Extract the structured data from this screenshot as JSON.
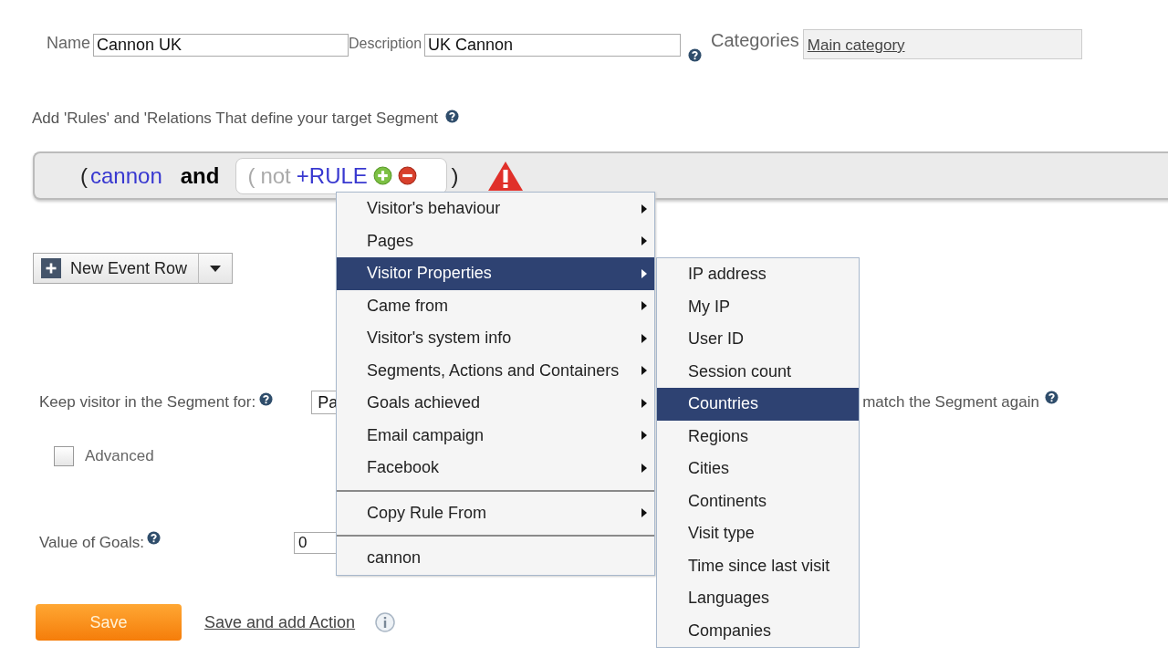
{
  "form": {
    "name": {
      "label": "Name",
      "value": "Cannon UK"
    },
    "description": {
      "label": "Description",
      "value": "UK Cannon"
    },
    "categories": {
      "label": "Categories",
      "link": "Main category"
    }
  },
  "rules_prompt": "Add 'Rules' and 'Relations That define your target Segment",
  "rule_bar": {
    "open": "(",
    "rule": "cannon",
    "operator": "and",
    "group": {
      "open": "(",
      "negation": "not",
      "add": "+RULE"
    },
    "close": ")"
  },
  "new_event_row": "New Event Row",
  "keep": {
    "label": "Keep visitor in the Segment for:",
    "select": "Pa",
    "tail": "match the Segment again"
  },
  "advanced": {
    "label": "Advanced",
    "checked": false
  },
  "goals": {
    "label": "Value of Goals:",
    "value": "0"
  },
  "save": "Save",
  "save_add": "Save and add Action",
  "menu": {
    "sections": [
      [
        {
          "label": "Visitor's behaviour",
          "kind": "submenu",
          "selected": false
        },
        {
          "label": "Pages",
          "kind": "submenu",
          "selected": false
        },
        {
          "label": "Visitor Properties",
          "kind": "submenu",
          "selected": true
        },
        {
          "label": "Came from",
          "kind": "submenu",
          "selected": false
        },
        {
          "label": "Visitor's system info",
          "kind": "submenu",
          "selected": false
        },
        {
          "label": "Segments, Actions and Containers",
          "kind": "submenu",
          "selected": false
        },
        {
          "label": "Goals achieved",
          "kind": "submenu",
          "selected": false
        },
        {
          "label": "Email campaign",
          "kind": "submenu",
          "selected": false
        },
        {
          "label": "Facebook",
          "kind": "submenu",
          "selected": false
        }
      ],
      [
        {
          "label": "Copy Rule From",
          "kind": "submenu",
          "selected": false
        }
      ],
      [
        {
          "label": "cannon",
          "kind": "plain",
          "selected": false
        }
      ]
    ]
  },
  "submenu": [
    {
      "label": "IP address",
      "selected": false
    },
    {
      "label": "My IP",
      "selected": false
    },
    {
      "label": "User ID",
      "selected": false
    },
    {
      "label": "Session count",
      "selected": false
    },
    {
      "label": "Countries",
      "selected": true
    },
    {
      "label": "Regions",
      "selected": false
    },
    {
      "label": "Cities",
      "selected": false
    },
    {
      "label": "Continents",
      "selected": false
    },
    {
      "label": "Visit type",
      "selected": false
    },
    {
      "label": "Time since last visit",
      "selected": false
    },
    {
      "label": "Languages",
      "selected": false
    },
    {
      "label": "Companies",
      "selected": false
    }
  ]
}
